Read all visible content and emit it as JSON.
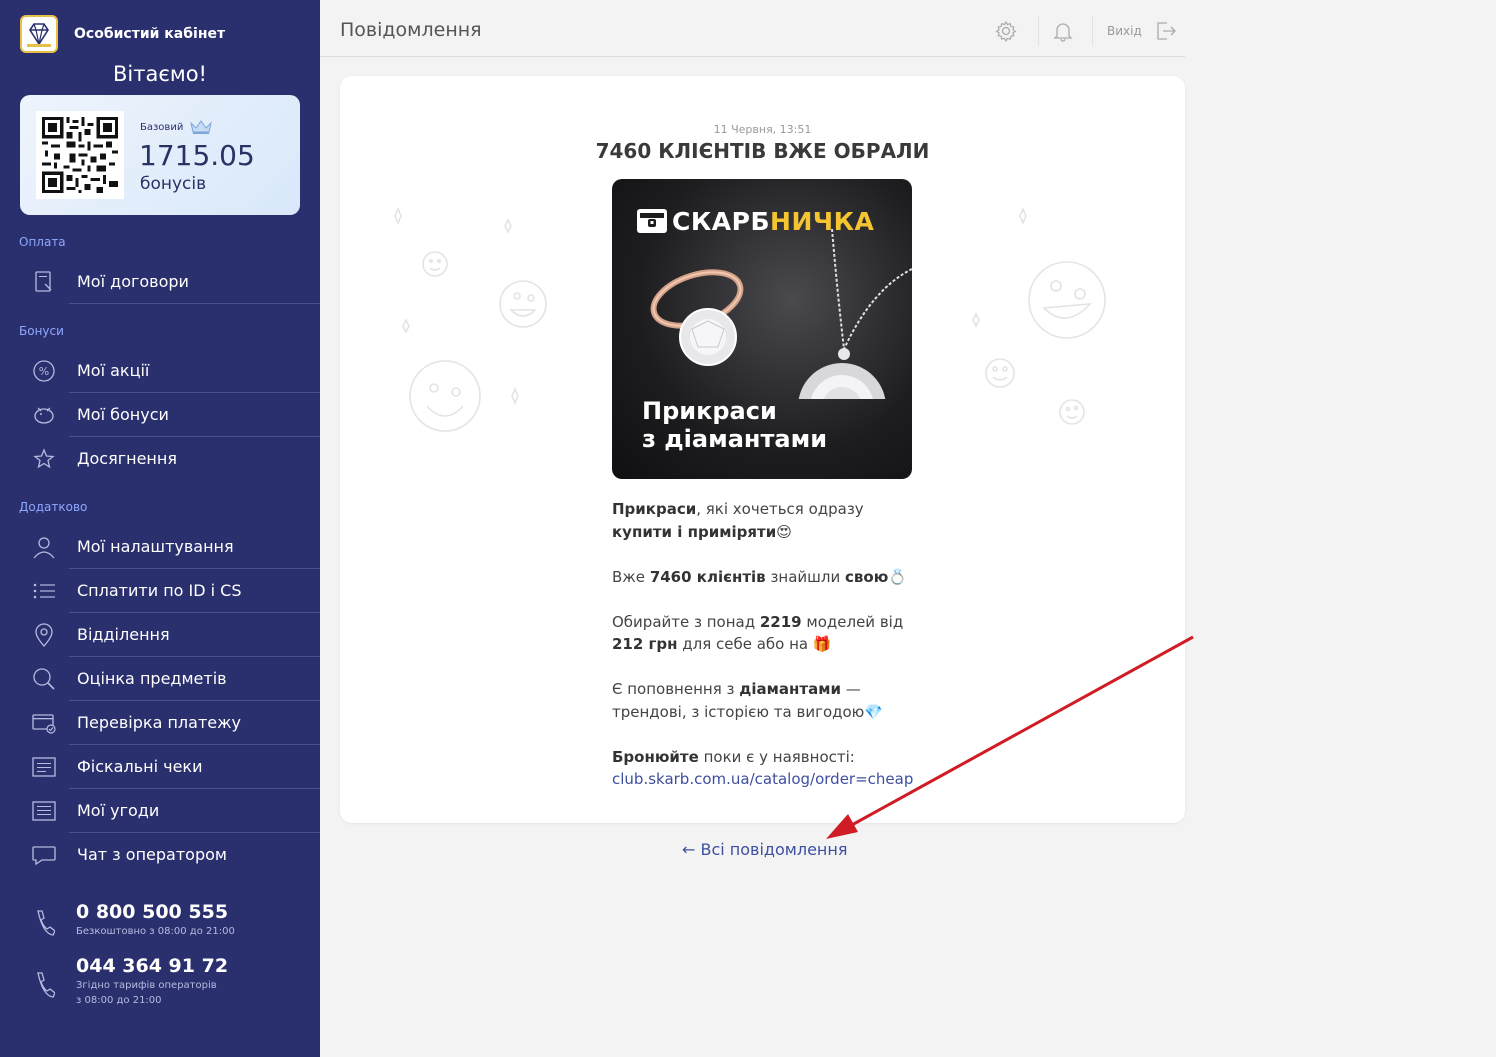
{
  "sidebar": {
    "brand_title": "Особистий кабінет",
    "welcome": "Вітаємо!",
    "card": {
      "level": "Базовий",
      "amount": "1715.05",
      "unit": "бонусів"
    },
    "sections": {
      "payment": "Оплата",
      "bonuses": "Бонуси",
      "extra": "Додатково"
    },
    "items": {
      "contracts": "Мої договори",
      "promos": "Мої акції",
      "bonuses": "Мої бонуси",
      "achievements": "Досягнення",
      "settings": "Мої налаштування",
      "pay_by_id": "Сплатити по ID і CS",
      "branches": "Відділення",
      "appraisal": "Оцінка предметів",
      "payment_check": "Перевірка платежу",
      "receipts": "Фіскальні чеки",
      "agreements": "Мої угоди",
      "chat": "Чат з оператором"
    },
    "phones": [
      {
        "number": "0 800 500 555",
        "note1": "Безкоштовно з 08:00 до 21:00",
        "note2": ""
      },
      {
        "number": "044 364 91 72",
        "note1": "Згідно тарифів операторів",
        "note2": "з 08:00 до 21:00"
      }
    ]
  },
  "header": {
    "title": "Повідомлення",
    "logout": "Вихід"
  },
  "message": {
    "date": "11 Червня, 13:51",
    "title": "7460 КЛІЄНТІВ ВЖЕ ОБРАЛИ",
    "banner": {
      "brand_a": "СКАРБ",
      "brand_b": "НИЧКА",
      "caption1": "Прикраси",
      "caption2": "з діамантами"
    },
    "p1_b1": "Прикраси",
    "p1_t1": ", які хочеться одразу",
    "p1_b2": "купити і приміряти",
    "p1_e": "😍",
    "p2_t1": "Вже ",
    "p2_b1": "7460 клієнтів",
    "p2_t2": " знайшли ",
    "p2_b2": "свою",
    "p2_e": "💍",
    "p3_t1": "Обирайте з понад ",
    "p3_b1": "2219",
    "p3_t2": " моделей від",
    "p3_b2": "212 грн",
    "p3_t3": " для себе або на ",
    "p3_e": "🎁",
    "p4_t1": "Є поповнення з ",
    "p4_b1": "діамантами",
    "p4_t2": " —",
    "p4_t3": "трендові, з історією та вигодою",
    "p4_e": "💎",
    "p5_b1": "Бронюйте",
    "p5_t1": " поки є у наявності:",
    "link": "club.skarb.com.ua/catalog/order=cheap"
  },
  "all_messages_link": "← Всі повідомлення",
  "colors": {
    "sidebar_bg": "#2a2f6e",
    "accent_link": "#3e4fa0",
    "section_title": "#8fa8ff",
    "arrow": "#d01c24"
  }
}
